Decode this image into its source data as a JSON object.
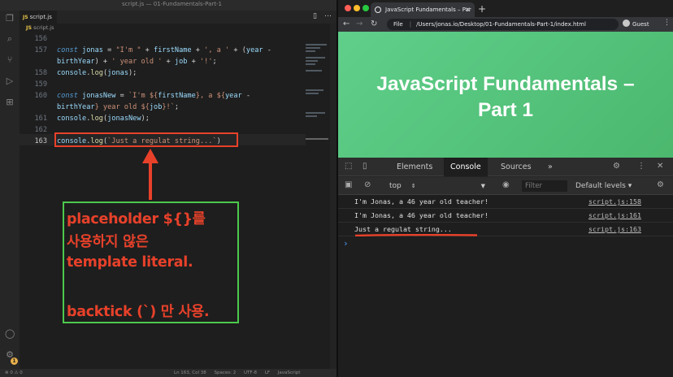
{
  "editor": {
    "title": "script.js — 01-Fundamentals-Part-1",
    "tab": {
      "ext": "JS",
      "label": "script.js"
    },
    "breadcrumb": {
      "ext": "JS",
      "label": "script.js"
    },
    "lines": [
      {
        "num": "156",
        "tokens": []
      },
      {
        "num": "157",
        "tokens": [
          [
            "k",
            "const "
          ],
          [
            "v",
            "jonas"
          ],
          [
            "p",
            " = "
          ],
          [
            "s",
            "\"I'm \""
          ],
          [
            "p",
            " + "
          ],
          [
            "v",
            "firstName"
          ],
          [
            "p",
            " + "
          ],
          [
            "s",
            "', a '"
          ],
          [
            "p",
            " + ("
          ],
          [
            "v",
            "year"
          ],
          [
            "p",
            " -"
          ]
        ]
      },
      {
        "num": "",
        "tokens": [
          [
            "v",
            "birthYear"
          ],
          [
            "p",
            ") + "
          ],
          [
            "s",
            "' year old '"
          ],
          [
            "p",
            " + "
          ],
          [
            "v",
            "job"
          ],
          [
            "p",
            " + "
          ],
          [
            "s",
            "'!'"
          ],
          [
            "p",
            ";"
          ]
        ]
      },
      {
        "num": "158",
        "tokens": [
          [
            "v",
            "console"
          ],
          [
            "p",
            "."
          ],
          [
            "f",
            "log"
          ],
          [
            "p",
            "("
          ],
          [
            "v",
            "jonas"
          ],
          [
            "p",
            ");"
          ]
        ]
      },
      {
        "num": "159",
        "tokens": []
      },
      {
        "num": "160",
        "tokens": [
          [
            "k",
            "const "
          ],
          [
            "v",
            "jonasNew"
          ],
          [
            "p",
            " = "
          ],
          [
            "s",
            "`I'm ${"
          ],
          [
            "v",
            "firstName"
          ],
          [
            "s",
            "}, a ${"
          ],
          [
            "v",
            "year"
          ],
          [
            "p",
            " -"
          ]
        ]
      },
      {
        "num": "",
        "tokens": [
          [
            "v",
            "birthYear"
          ],
          [
            "s",
            "} year old ${"
          ],
          [
            "v",
            "job"
          ],
          [
            "s",
            "}!`"
          ],
          [
            "p",
            ";"
          ]
        ]
      },
      {
        "num": "161",
        "tokens": [
          [
            "v",
            "console"
          ],
          [
            "p",
            "."
          ],
          [
            "f",
            "log"
          ],
          [
            "p",
            "("
          ],
          [
            "v",
            "jonasNew"
          ],
          [
            "p",
            ");"
          ]
        ]
      },
      {
        "num": "162",
        "tokens": []
      },
      {
        "num": "163",
        "tokens": [
          [
            "v",
            "console"
          ],
          [
            "p",
            "."
          ],
          [
            "f",
            "log"
          ],
          [
            "p",
            "("
          ],
          [
            "s",
            "`Just a regulat string...`"
          ],
          [
            "p",
            ")"
          ]
        ]
      }
    ],
    "annotation": {
      "lines": [
        "placeholder ${}를",
        "사용하지 않은",
        "template literal.",
        "",
        "backtick (`) 만 사용."
      ]
    },
    "status": {
      "left": "⊗ 0  ⚠ 0",
      "position": "Ln 163, Col 38",
      "spaces": "Spaces: 2",
      "encoding": "UTF-8",
      "eol": "LF",
      "language": "JavaScript"
    },
    "badge": "1"
  },
  "browser": {
    "tab_title": "JavaScript Fundamentals – Par",
    "address_label": "File",
    "address": "/Users/jonas.io/Desktop/01-Fundamentals-Part-1/index.html",
    "profile": "Guest",
    "page_title_line1": "JavaScript Fundamentals –",
    "page_title_line2": "Part 1",
    "colors": {
      "page_bg": "#5fcf8a",
      "accent_red": "#e8412a",
      "note_green": "#4cc94c"
    }
  },
  "devtools": {
    "tabs": [
      "Elements",
      "Console",
      "Sources",
      "»"
    ],
    "active_tab": "Console",
    "context": "top",
    "filter_placeholder": "Filter",
    "levels": "Default levels ▾",
    "rows": [
      {
        "msg": "I'm Jonas, a 46 year old teacher!",
        "src": "script.js:158"
      },
      {
        "msg": "I'm Jonas, a 46 year old teacher!",
        "src": "script.js:161"
      },
      {
        "msg": "Just a regulat string...",
        "src": "script.js:163"
      }
    ],
    "prompt": "›"
  }
}
